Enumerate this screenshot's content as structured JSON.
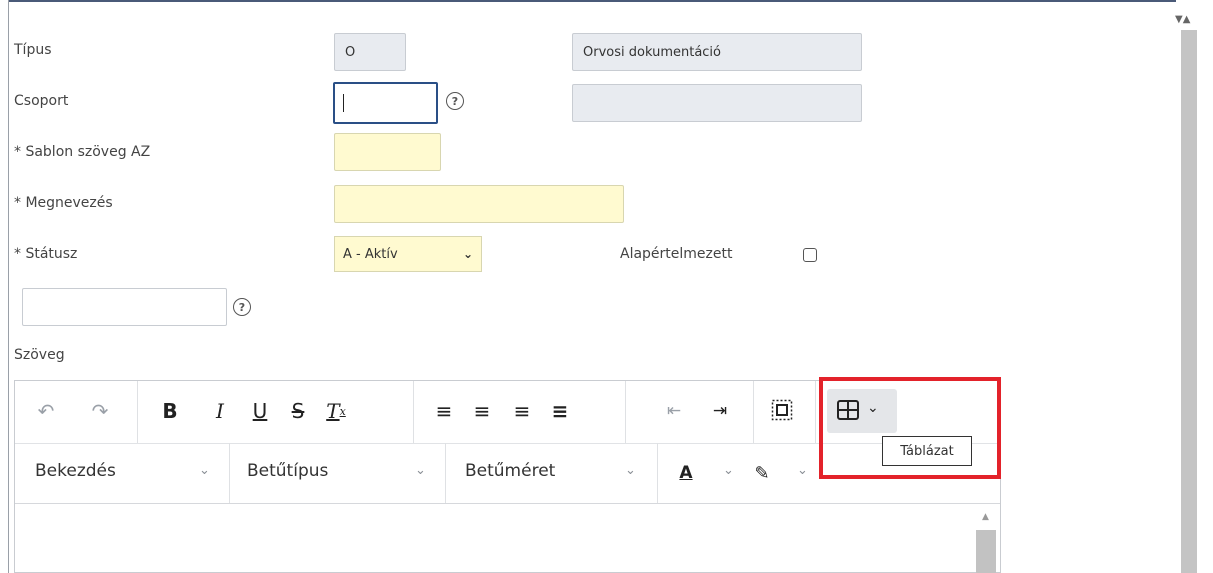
{
  "form": {
    "tipus": {
      "label": "Típus",
      "code": "O",
      "name": "Orvosi dokumentáció"
    },
    "csoport": {
      "label": "Csoport",
      "value": "",
      "name": ""
    },
    "sablon_az": {
      "label": "* Sablon szöveg AZ",
      "value": ""
    },
    "megnevezes": {
      "label": "* Megnevezés",
      "value": ""
    },
    "statusz": {
      "label": "* Státusz",
      "selected": "A - Aktív"
    },
    "alapertelmezett": {
      "label": "Alapértelmezett",
      "checked": false
    },
    "extra_field": {
      "value": ""
    },
    "szoveg_label": "Szöveg"
  },
  "editor": {
    "toolbar_icons": [
      "undo-icon",
      "redo-icon",
      "bold-icon",
      "italic-icon",
      "underline-icon",
      "strikethrough-icon",
      "clear-formatting-icon",
      "align-left-icon",
      "align-center-icon",
      "align-right-icon",
      "align-justify-icon",
      "outdent-icon",
      "indent-icon",
      "select-all-icon",
      "table-icon"
    ],
    "paragraph": "Bekezdés",
    "font": "Betűtípus",
    "size": "Betűméret",
    "tooltip": "Táblázat"
  },
  "colors": {
    "highlight_box": "#e3222a",
    "required_bg": "#fffad0",
    "readonly_bg": "#e8ebf0"
  }
}
